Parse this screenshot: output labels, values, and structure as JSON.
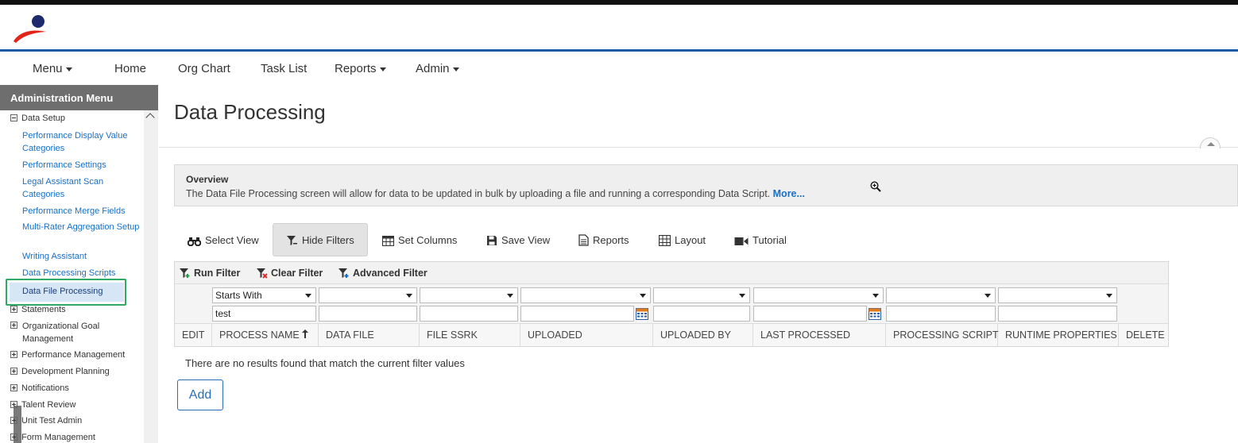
{
  "nav": {
    "menu": "Menu",
    "home": "Home",
    "org_chart": "Org Chart",
    "task_list": "Task List",
    "reports": "Reports",
    "admin": "Admin"
  },
  "sidebar": {
    "title": "Administration Menu",
    "data_setup": "Data Setup",
    "links": [
      "Performance Display Value Categories",
      "Performance Settings",
      "Legal Assistant Scan Categories",
      "Performance Merge Fields",
      "Multi-Rater Aggregation Setup",
      "Writing Assistant",
      "Data Processing Scripts",
      "Data File Processing"
    ],
    "groups": [
      "Statements",
      "Organizational Goal Management",
      "Performance Management",
      "Development Planning",
      "Notifications",
      "Talent Review",
      "Unit Test Admin",
      "Form Management"
    ]
  },
  "page": {
    "title": "Data Processing"
  },
  "overview": {
    "title": "Overview",
    "text": "The Data File Processing screen will allow for data to be updated in bulk by uploading a file and running a corresponding Data Script.",
    "more": "More..."
  },
  "toolbar": {
    "select_view": "Select View",
    "hide_filters": "Hide Filters",
    "set_columns": "Set Columns",
    "save_view": "Save View",
    "reports": "Reports",
    "layout": "Layout",
    "tutorial": "Tutorial"
  },
  "filterbar": {
    "run_filter": "Run Filter",
    "clear_filter": "Clear Filter",
    "advanced_filter": "Advanced Filter"
  },
  "filters": {
    "process_name_operator": "Starts With",
    "process_name_value": "test"
  },
  "columns": {
    "edit": "EDIT",
    "process_name": "PROCESS NAME",
    "data_file": "DATA FILE",
    "file_ssrk": "FILE SSRK",
    "uploaded": "UPLOADED",
    "uploaded_by": "UPLOADED BY",
    "last_processed": "LAST PROCESSED",
    "processing_script": "PROCESSING SCRIPT",
    "runtime_properties": "RUNTIME PROPERTIES",
    "delete": "DELETE"
  },
  "results": {
    "empty": "There are no results found that match the current filter values"
  },
  "actions": {
    "add": "Add"
  },
  "colors": {
    "brand_blue": "#1f5aa6",
    "link": "#1a6fc4",
    "sidebar_header": "#6e6e6e",
    "selected_outline": "#2eaa64"
  }
}
